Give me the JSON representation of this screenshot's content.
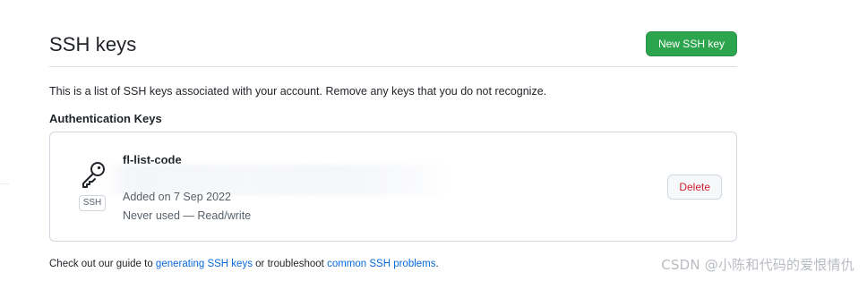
{
  "header": {
    "title": "SSH keys",
    "new_button_label": "New SSH key"
  },
  "intro": {
    "text": "This is a list of SSH keys associated with your account. Remove any keys that you do not recognize."
  },
  "section": {
    "heading": "Authentication Keys"
  },
  "keys": [
    {
      "title": "fl-list-code",
      "badge": "SSH",
      "added": "Added on 7 Sep 2022",
      "usage": "Never used — Read/write",
      "delete_label": "Delete"
    }
  ],
  "footer": {
    "prefix": "Check out our guide to ",
    "link1": "generating SSH keys",
    "middle": " or troubleshoot ",
    "link2": "common SSH problems",
    "suffix": "."
  },
  "watermark": "CSDN @小陈和代码的爱恨情仇",
  "colors": {
    "primary_button": "#2da44e",
    "danger_text": "#cf222e",
    "link": "#0969da",
    "muted_text": "#57606a",
    "border": "#d0d7de"
  },
  "icons": {
    "key": "key-icon"
  }
}
